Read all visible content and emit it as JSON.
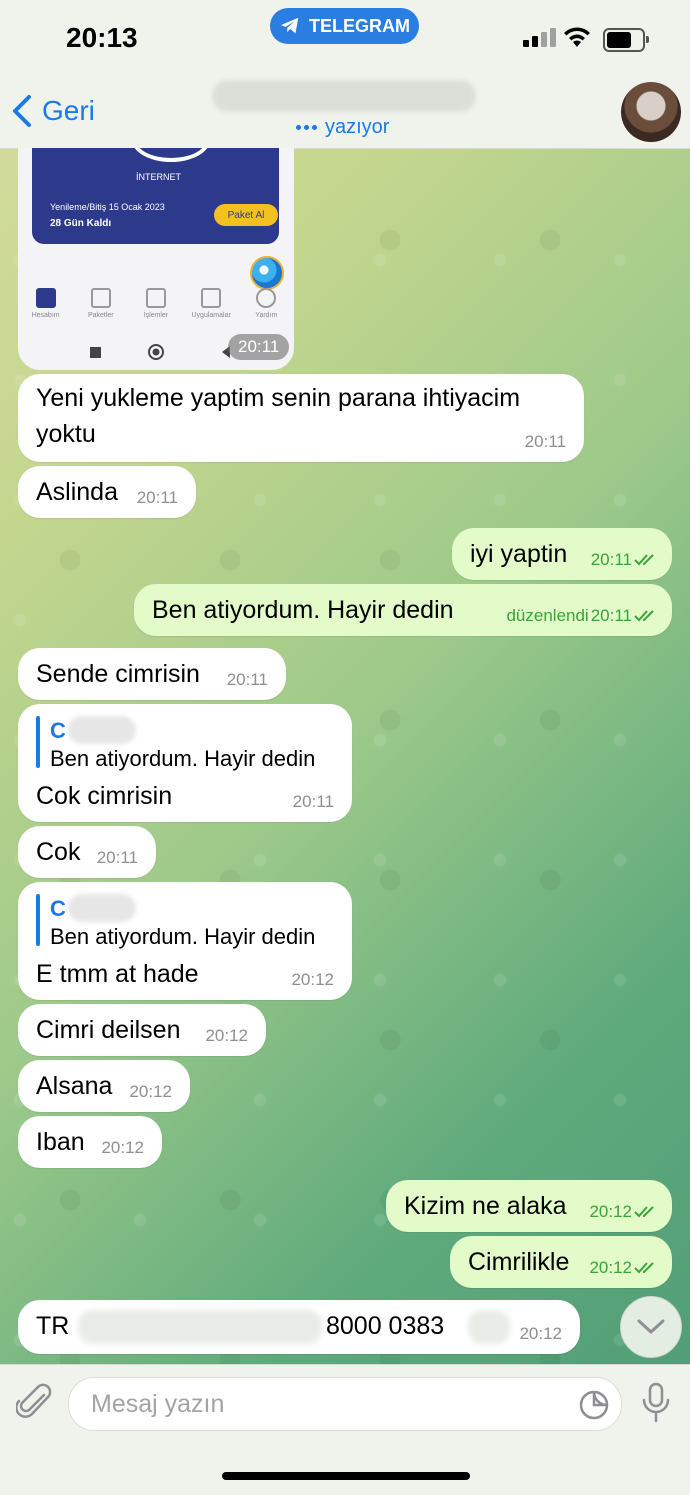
{
  "status_bar": {
    "time": "20:13",
    "app_pill": "TELEGRAM"
  },
  "header": {
    "back_label": "Geri",
    "status": "yazıyor"
  },
  "image_message": {
    "service": "İNTERNET",
    "renewal": "Yenileme/Bitiş 15 Ocak 2023",
    "days_left": "28 Gün Kaldı",
    "package_button": "Paket Al",
    "tabs": [
      "Hesabım",
      "Paketler",
      "İşlemler",
      "Uygulamalar",
      "Yardım"
    ],
    "time": "20:11"
  },
  "messages": [
    {
      "id": "m1",
      "dir": "in",
      "text1": "Yeni yukleme yaptim senin parana ihtiyacim",
      "text2": "yoktu",
      "time": "20:11"
    },
    {
      "id": "m2",
      "dir": "in",
      "text": "Aslinda",
      "time": "20:11"
    },
    {
      "id": "m3",
      "dir": "out",
      "text": "iyi yaptin",
      "time": "20:11"
    },
    {
      "id": "m4",
      "dir": "out",
      "text": "Ben atiyordum. Hayir dedin",
      "edited": "düzenlendi",
      "time": "20:11"
    },
    {
      "id": "m5",
      "dir": "in",
      "text": "Sende cimrisin",
      "time": "20:11"
    },
    {
      "id": "m6",
      "dir": "in",
      "reply_name": "C",
      "reply_text": "Ben atiyordum. Hayir dedin",
      "text": "Cok cimrisin",
      "time": "20:11"
    },
    {
      "id": "m7",
      "dir": "in",
      "text": "Cok",
      "time": "20:11"
    },
    {
      "id": "m8",
      "dir": "in",
      "reply_name": "C",
      "reply_text": "Ben atiyordum. Hayir dedin",
      "text": "E tmm at hade",
      "time": "20:12"
    },
    {
      "id": "m9",
      "dir": "in",
      "text": "Cimri deilsen",
      "time": "20:12"
    },
    {
      "id": "m10",
      "dir": "in",
      "text": "Alsana",
      "time": "20:12"
    },
    {
      "id": "m11",
      "dir": "in",
      "text": "Iban",
      "time": "20:12"
    },
    {
      "id": "m12",
      "dir": "out",
      "text": "Kizim ne alaka",
      "time": "20:12"
    },
    {
      "id": "m13",
      "dir": "out",
      "text": "Cimrilikle",
      "time": "20:12"
    },
    {
      "id": "m14",
      "dir": "in",
      "prefix": "TR",
      "suffix": "8000 0383",
      "time": "20:12"
    }
  ],
  "input": {
    "placeholder": "Mesaj yazın"
  },
  "colors": {
    "accent": "#1a7ae6",
    "outgoing_bubble": "#e2fbc9",
    "incoming_bubble": "#ffffff",
    "read_ticks": "#3aa33a"
  }
}
